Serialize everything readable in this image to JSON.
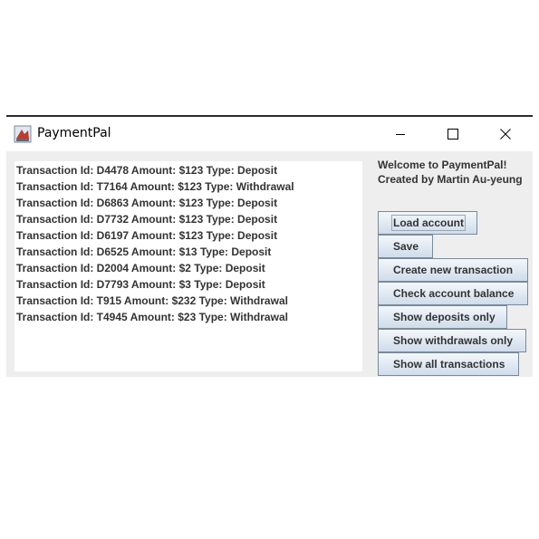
{
  "window": {
    "title": "PaymentPal"
  },
  "transactions": [
    "Transaction Id: D4478 Amount: $123 Type: Deposit",
    "Transaction Id: T7164 Amount: $123 Type: Withdrawal",
    "Transaction Id: D6863 Amount: $123 Type: Deposit",
    "Transaction Id: D7732 Amount: $123 Type: Deposit",
    "Transaction Id: D6197 Amount: $123 Type: Deposit",
    "Transaction Id: D6525 Amount: $13 Type: Deposit",
    "Transaction Id: D2004 Amount: $2 Type: Deposit",
    "Transaction Id: D7793 Amount: $3 Type: Deposit",
    "Transaction Id: T915 Amount: $232 Type: Withdrawal",
    "Transaction Id: T4945 Amount: $23 Type: Withdrawal"
  ],
  "sidebar": {
    "welcome": "Welcome to PaymentPal!",
    "credit": "Created by Martin Au-yeung",
    "buttons": {
      "load": "Load account",
      "save": "Save",
      "create": "Create new transaction",
      "check": "Check account balance",
      "deposits": "Show deposits only",
      "withdrawals": "Show withdrawals only",
      "all": "Show all transactions"
    }
  }
}
